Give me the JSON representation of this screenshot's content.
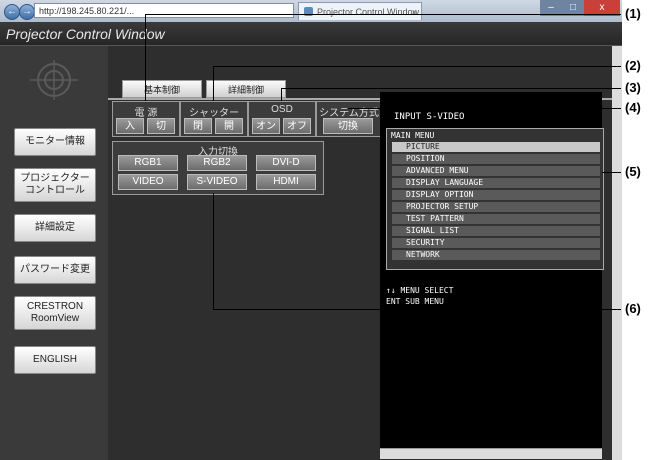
{
  "browser": {
    "address": "http://198.245.80.221/...",
    "tab_title": "Projector Control Window",
    "tab_close": "×",
    "back": "←",
    "forward": "→",
    "min": "–",
    "max": "□",
    "close": "x"
  },
  "app": {
    "title": "Projector Control Window"
  },
  "sidebar": {
    "items": [
      {
        "label": "モニター情報"
      },
      {
        "label": "プロジェクター\nコントロール"
      },
      {
        "label": "詳細設定"
      },
      {
        "label": "パスワード変更"
      },
      {
        "label": "CRESTRON\nRoomView"
      },
      {
        "label": "ENGLISH"
      }
    ]
  },
  "tabs": {
    "basic": "基本制御",
    "detail": "詳細制御"
  },
  "controls": {
    "power": {
      "label": "電 源",
      "on": "入",
      "off": "切"
    },
    "shutter": {
      "label": "シャッター",
      "close": "閉",
      "open": "開"
    },
    "osd": {
      "label": "OSD",
      "on": "オン",
      "off": "オフ"
    },
    "system": {
      "label": "システム方式",
      "switch": "切換"
    },
    "input": {
      "label": "入力切換",
      "buttons": [
        "RGB1",
        "RGB2",
        "DVI-D",
        "VIDEO",
        "S-VIDEO",
        "HDMI"
      ]
    }
  },
  "osd_screen": {
    "input": "INPUT S-VIDEO",
    "menu_title": "MAIN MENU",
    "items": [
      "PICTURE",
      "POSITION",
      "ADVANCED MENU",
      "DISPLAY LANGUAGE",
      "DISPLAY OPTION",
      "PROJECTOR SETUP",
      "TEST PATTERN",
      "SIGNAL LIST",
      "SECURITY",
      "NETWORK"
    ],
    "footer1": "↑↓  MENU SELECT",
    "footer2": "ENT  SUB MENU"
  },
  "callouts": [
    "(1)",
    "(2)",
    "(3)",
    "(4)",
    "(5)",
    "(6)"
  ]
}
